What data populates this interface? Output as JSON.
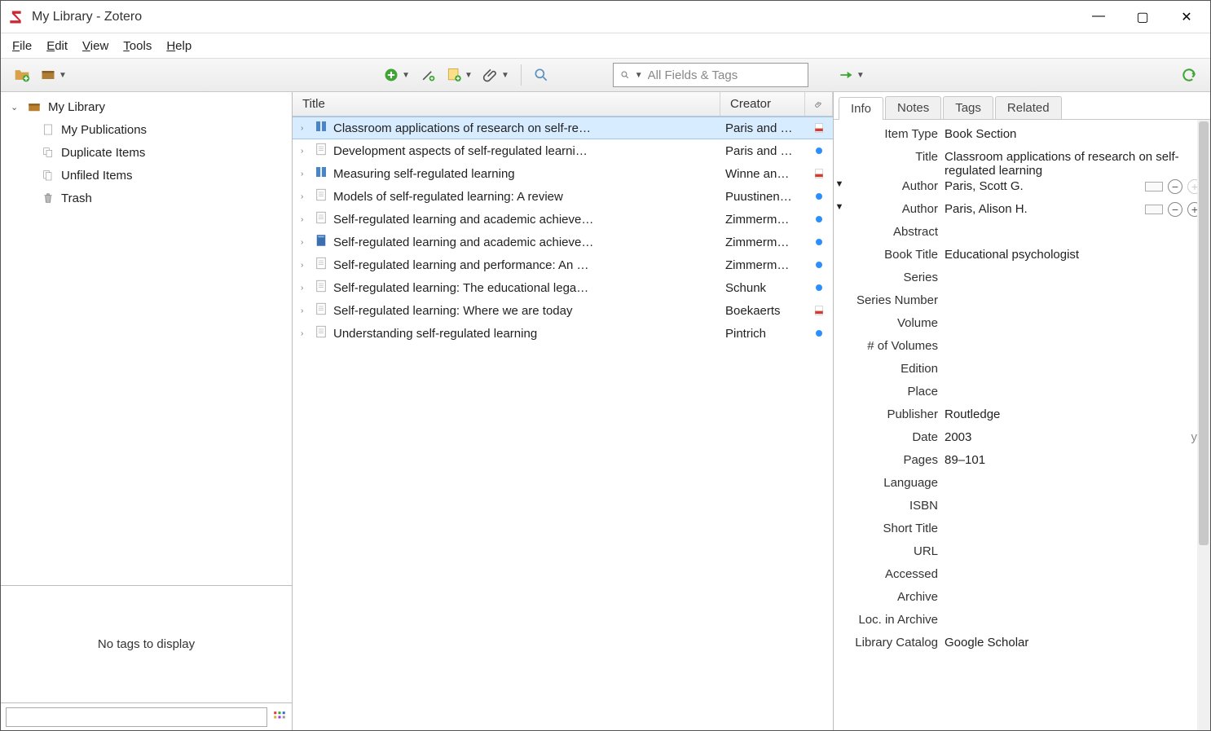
{
  "window": {
    "title": "My Library - Zotero"
  },
  "menus": {
    "file": "File",
    "edit": "Edit",
    "view": "View",
    "tools": "Tools",
    "help": "Help"
  },
  "search": {
    "placeholder": "All Fields & Tags"
  },
  "sidebar": {
    "library": "My Library",
    "items": [
      {
        "label": "My Publications"
      },
      {
        "label": "Duplicate Items"
      },
      {
        "label": "Unfiled Items"
      },
      {
        "label": "Trash"
      }
    ]
  },
  "tags": {
    "empty": "No tags to display"
  },
  "columns": {
    "title": "Title",
    "creator": "Creator"
  },
  "items": [
    {
      "title": "Classroom applications of research on self-re…",
      "creator": "Paris and …",
      "attach": "pdf",
      "icon": "book",
      "selected": true
    },
    {
      "title": "Development aspects of self-regulated learni…",
      "creator": "Paris and …",
      "attach": "dot",
      "icon": "page"
    },
    {
      "title": "Measuring self-regulated learning",
      "creator": "Winne an…",
      "attach": "pdf",
      "icon": "book"
    },
    {
      "title": "Models of self-regulated learning: A review",
      "creator": "Puustinen…",
      "attach": "dot",
      "icon": "page"
    },
    {
      "title": "Self-regulated learning and academic achieve…",
      "creator": "Zimmerm…",
      "attach": "dot",
      "icon": "page"
    },
    {
      "title": "Self-regulated learning and academic achieve…",
      "creator": "Zimmerm…",
      "attach": "dot",
      "icon": "bookblue"
    },
    {
      "title": "Self-regulated learning and performance: An …",
      "creator": "Zimmerm…",
      "attach": "dot",
      "icon": "page"
    },
    {
      "title": "Self-regulated learning: The educational lega…",
      "creator": "Schunk",
      "attach": "dot",
      "icon": "page"
    },
    {
      "title": "Self-regulated learning: Where we are today",
      "creator": "Boekaerts",
      "attach": "pdf",
      "icon": "page"
    },
    {
      "title": "Understanding self-regulated learning",
      "creator": "Pintrich",
      "attach": "dot",
      "icon": "page"
    }
  ],
  "tabs": {
    "info": "Info",
    "notes": "Notes",
    "tags": "Tags",
    "related": "Related"
  },
  "meta": {
    "labels": {
      "itemType": "Item Type",
      "title": "Title",
      "author": "Author",
      "abstract": "Abstract",
      "bookTitle": "Book Title",
      "series": "Series",
      "seriesNumber": "Series Number",
      "volume": "Volume",
      "numVolumes": "# of Volumes",
      "edition": "Edition",
      "place": "Place",
      "publisher": "Publisher",
      "date": "Date",
      "pages": "Pages",
      "language": "Language",
      "isbn": "ISBN",
      "shortTitle": "Short Title",
      "url": "URL",
      "accessed": "Accessed",
      "archive": "Archive",
      "locArchive": "Loc. in Archive",
      "libraryCatalog": "Library Catalog"
    },
    "values": {
      "itemType": "Book Section",
      "title": "Classroom applications of research on self-regulated learning",
      "author1": "Paris, Scott G.",
      "author2": "Paris, Alison H.",
      "bookTitle": "Educational psychologist",
      "publisher": "Routledge",
      "date": "2003",
      "dateHint": "y",
      "pages": "89–101",
      "libraryCatalog": "Google Scholar"
    }
  }
}
